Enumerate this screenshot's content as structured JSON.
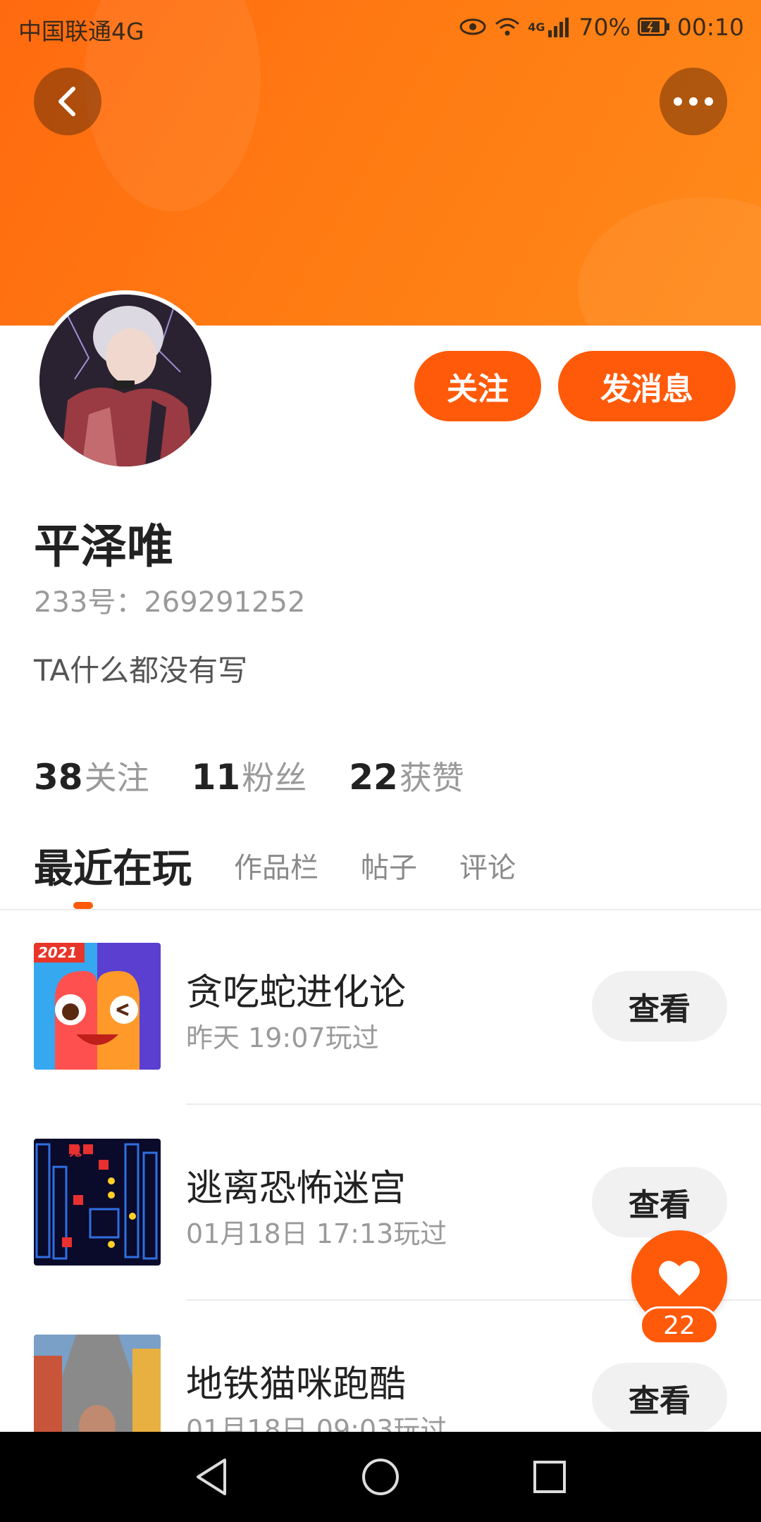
{
  "status_bar": {
    "carrier": "中国联通4G",
    "network_badge": "4G",
    "battery": "70%",
    "time": "00:10"
  },
  "profile": {
    "name": "平泽唯",
    "id_label": "233号：",
    "id_value": "269291252",
    "bio": "TA什么都没有写"
  },
  "actions": {
    "follow": "关注",
    "message": "发消息"
  },
  "stats": [
    {
      "num": "38",
      "label": "关注"
    },
    {
      "num": "11",
      "label": "粉丝"
    },
    {
      "num": "22",
      "label": "获赞"
    }
  ],
  "tabs": [
    {
      "label": "最近在玩",
      "active": true
    },
    {
      "label": "作品栏",
      "active": false
    },
    {
      "label": "帖子",
      "active": false
    },
    {
      "label": "评论",
      "active": false
    }
  ],
  "games": [
    {
      "name": "贪吃蛇进化论",
      "time": "昨天 19:07玩过",
      "button": "查看",
      "icon_badge": "2021"
    },
    {
      "name": "逃离恐怖迷宫",
      "time": "01月18日 17:13玩过",
      "button": "查看",
      "icon_badge": "鬼"
    },
    {
      "name": "地铁猫咪跑酷",
      "time": "01月18日 09:03玩过",
      "button": "查看"
    }
  ],
  "like": {
    "count": "22"
  },
  "colors": {
    "accent": "#ff5a0a",
    "header": "#ff7a12"
  }
}
